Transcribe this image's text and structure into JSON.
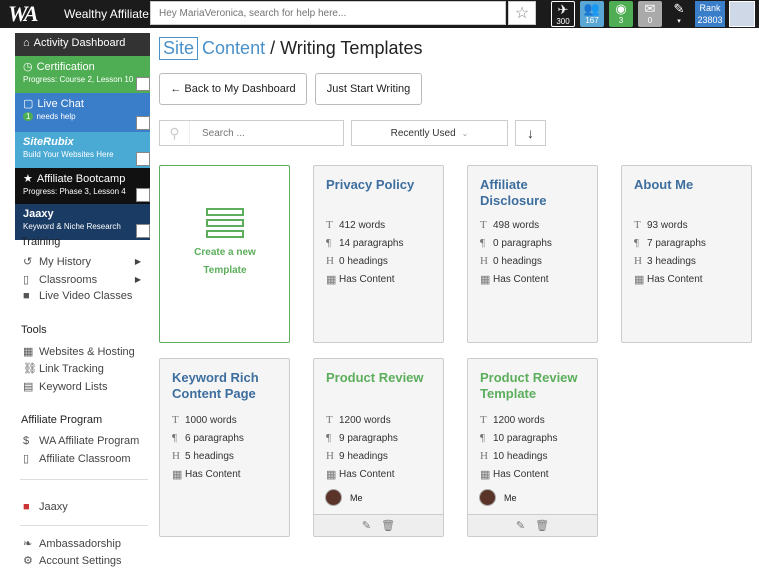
{
  "topbar": {
    "logo_mark": "WA",
    "logo_text": "Wealthy Affiliate",
    "search_placeholder": "Hey MariaVeronica, search for help here...",
    "icons": [
      {
        "name": "airplane-icon",
        "count": "300",
        "color": "#1b1b1b"
      },
      {
        "name": "community-icon",
        "count": "167",
        "color": "#5aa7d6"
      },
      {
        "name": "globe-icon",
        "count": "3",
        "color": "#4fae53"
      },
      {
        "name": "mail-icon",
        "count": "0",
        "color": "#aaaaaa"
      },
      {
        "name": "pen-icon",
        "count": "",
        "color": "#1b1b1b"
      }
    ],
    "rank_label": "Rank",
    "rank_value": "23803"
  },
  "sidebar": {
    "promo": [
      {
        "title": "Activity Dashboard",
        "sub": "",
        "color": "#333333"
      },
      {
        "title": "Certification",
        "sub": "Progress: Course 2, Lesson 10",
        "color": "#4fae53"
      },
      {
        "title": "Live Chat",
        "sub": "needs help",
        "badge": "1",
        "color": "#3a7dc9"
      },
      {
        "title": "SiteRubix",
        "sub": "Build Your Websites Here",
        "color": "#4aaad4"
      },
      {
        "title": "Affiliate Bootcamp",
        "sub": "Progress: Phase 3, Lesson 4",
        "color": "#111111"
      },
      {
        "title": "Jaaxy",
        "sub": "Keyword & Niche Research",
        "color": "#1a3b63"
      }
    ],
    "training_title": "Training",
    "training": [
      "My History",
      "Classrooms",
      "Live Video Classes"
    ],
    "tools_title": "Tools",
    "tools": [
      "Websites & Hosting",
      "Link Tracking",
      "Keyword Lists"
    ],
    "affiliate_title": "Affiliate Program",
    "affiliate": [
      "WA Affiliate Program",
      "Affiliate Classroom"
    ],
    "jaaxy": "Jaaxy",
    "bottom": [
      "Ambassadorship",
      "Account Settings"
    ]
  },
  "main": {
    "title_site": "Site",
    "title_content": "Content",
    "title_rest": "/ Writing Templates",
    "back_button": "Back to My Dashboard",
    "start_button": "Just Start Writing",
    "search_placeholder": "Search ...",
    "sort_value": "Recently Used",
    "create_label": "Create a new Template",
    "cards": [
      {
        "title": "Privacy Policy",
        "words": "412 words",
        "paragraphs": "14 paragraphs",
        "headings": "0 headings",
        "content": "Has Content",
        "owner": ""
      },
      {
        "title": "Affiliate Disclosure",
        "words": "498 words",
        "paragraphs": "0 paragraphs",
        "headings": "0 headings",
        "content": "Has Content",
        "owner": ""
      },
      {
        "title": "About Me",
        "words": "93 words",
        "paragraphs": "7 paragraphs",
        "headings": "3 headings",
        "content": "Has Content",
        "owner": ""
      },
      {
        "title": "Keyword Rich Content Page",
        "words": "1000 words",
        "paragraphs": "6 paragraphs",
        "headings": "5 headings",
        "content": "Has Content",
        "owner": ""
      },
      {
        "title": "Product Review",
        "words": "1200 words",
        "paragraphs": "9 paragraphs",
        "headings": "9 headings",
        "content": "Has Content",
        "owner": "Me"
      },
      {
        "title": "Product Review Template",
        "words": "1200 words",
        "paragraphs": "10 paragraphs",
        "headings": "10 headings",
        "content": "Has Content",
        "owner": "Me"
      }
    ]
  }
}
